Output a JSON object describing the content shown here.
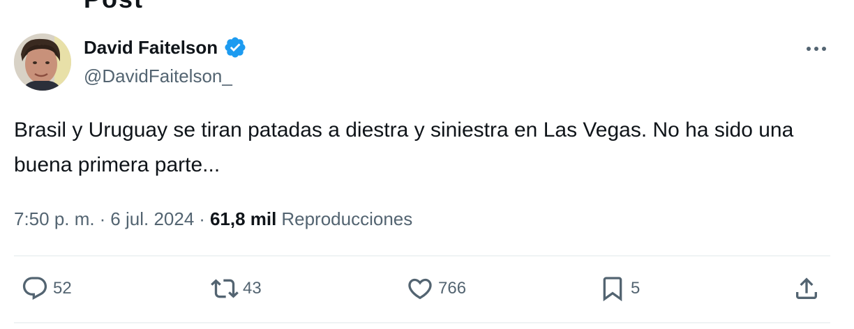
{
  "colors": {
    "text_primary": "#0f1419",
    "text_secondary": "#536471",
    "verified_blue": "#1d9bf0",
    "divider": "#eff3f4"
  },
  "header": {
    "partial_title": "Post"
  },
  "author": {
    "name": "David Faitelson",
    "handle": "@DavidFaitelson_",
    "verified": true,
    "avatar_icon": "profile-photo",
    "verified_icon": "verified-badge-icon"
  },
  "more_icon": "more-horizontal-icon",
  "tweet": {
    "text": "Brasil y Uruguay se tiran patadas a diestra y siniestra en Las Vegas. No ha sido una buena primera parte...",
    "time": "7:50 p. m.",
    "separator": "·",
    "date": "6 jul. 2024",
    "views_count": "61,8 mil",
    "views_label": "Reproducciones"
  },
  "actions": {
    "reply": {
      "icon": "reply-icon",
      "count": "52"
    },
    "retweet": {
      "icon": "retweet-icon",
      "count": "43"
    },
    "like": {
      "icon": "heart-icon",
      "count": "766"
    },
    "bookmark": {
      "icon": "bookmark-icon",
      "count": "5"
    },
    "share": {
      "icon": "share-icon"
    }
  }
}
